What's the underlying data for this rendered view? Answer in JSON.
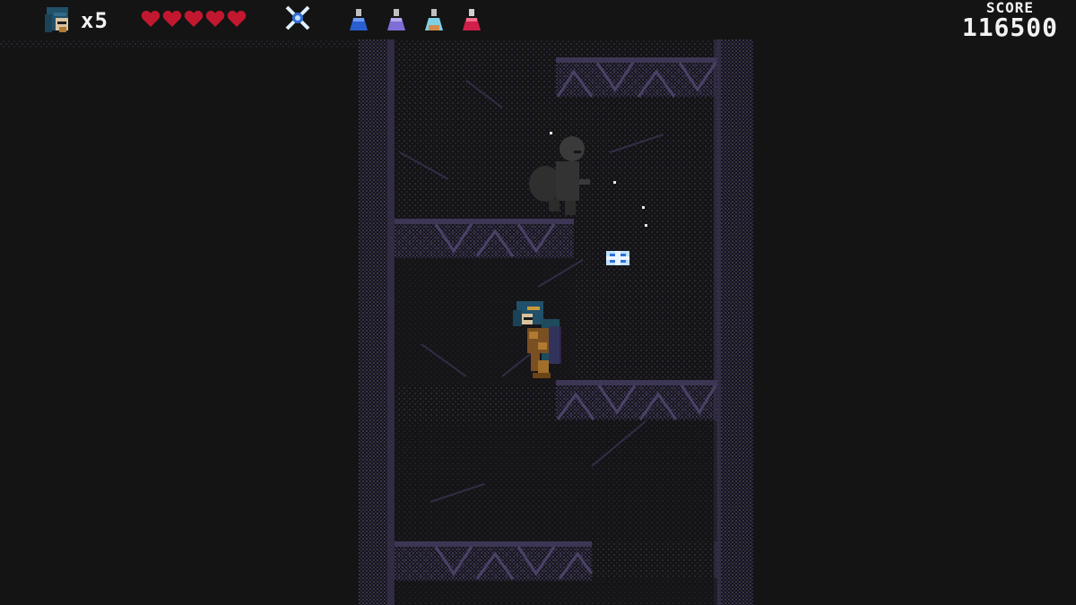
{
  "hud": {
    "lives_text": "x5",
    "hearts": 5,
    "relic": "blue-star-relic-icon",
    "potions": [
      "blue-potion-icon",
      "purple-potion-icon",
      "cyan-potion-icon",
      "red-potion-icon"
    ],
    "score_label": "SCORE",
    "score_value": "116500"
  },
  "colors": {
    "background": "#141414",
    "heart": "#c2182f",
    "rock": "#3a3350",
    "gem": "#2f6fd6"
  }
}
